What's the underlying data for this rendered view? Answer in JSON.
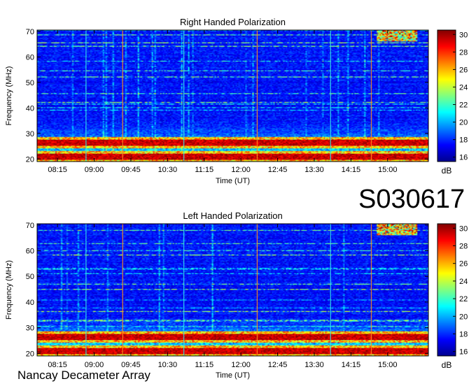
{
  "observation_id": "S030617",
  "instrument": "Nancay Decameter Array",
  "chart_data": [
    {
      "type": "heatmap",
      "title": "Right Handed Polarization",
      "xlabel": "Time (UT)",
      "ylabel": "Frequency (MHz)",
      "x_ticks": [
        "08:15",
        "09:00",
        "09:45",
        "10:30",
        "11:15",
        "12:00",
        "12:45",
        "13:30",
        "14:15",
        "15:00"
      ],
      "y_ticks": [
        20,
        30,
        40,
        50,
        60,
        70
      ],
      "ylim": [
        19,
        70.5
      ],
      "colorbar": {
        "label": "dB",
        "ticks": [
          16,
          18,
          20,
          22,
          24,
          26,
          28,
          30
        ],
        "range": [
          15.5,
          30.5
        ]
      },
      "features": {
        "strong_bands_mhz": [
          21,
          26.5
        ],
        "calibration_times": [
          "08:50",
          "09:35",
          "10:50",
          "12:20",
          "13:50",
          "14:40"
        ],
        "burst_region": {
          "freq_mhz": [
            66,
            70.5
          ],
          "time": [
            "14:45",
            "15:35"
          ]
        }
      }
    },
    {
      "type": "heatmap",
      "title": "Left Handed Polarization",
      "xlabel": "Time (UT)",
      "ylabel": "Frequency (MHz)",
      "x_ticks": [
        "08:15",
        "09:00",
        "09:45",
        "10:30",
        "11:15",
        "12:00",
        "12:45",
        "13:30",
        "14:15",
        "15:00"
      ],
      "y_ticks": [
        20,
        30,
        40,
        50,
        60,
        70
      ],
      "ylim": [
        19,
        70.5
      ],
      "colorbar": {
        "label": "dB",
        "ticks": [
          16,
          18,
          20,
          22,
          24,
          26,
          28,
          30
        ],
        "range": [
          15.5,
          30.5
        ]
      },
      "features": {
        "strong_bands_mhz": [
          21,
          26.5
        ],
        "calibration_times": [
          "08:50",
          "09:35",
          "10:50",
          "12:20",
          "13:50",
          "14:40"
        ],
        "burst_region": {
          "freq_mhz": [
            66,
            70.5
          ],
          "time": [
            "14:45",
            "15:35"
          ]
        }
      }
    }
  ]
}
